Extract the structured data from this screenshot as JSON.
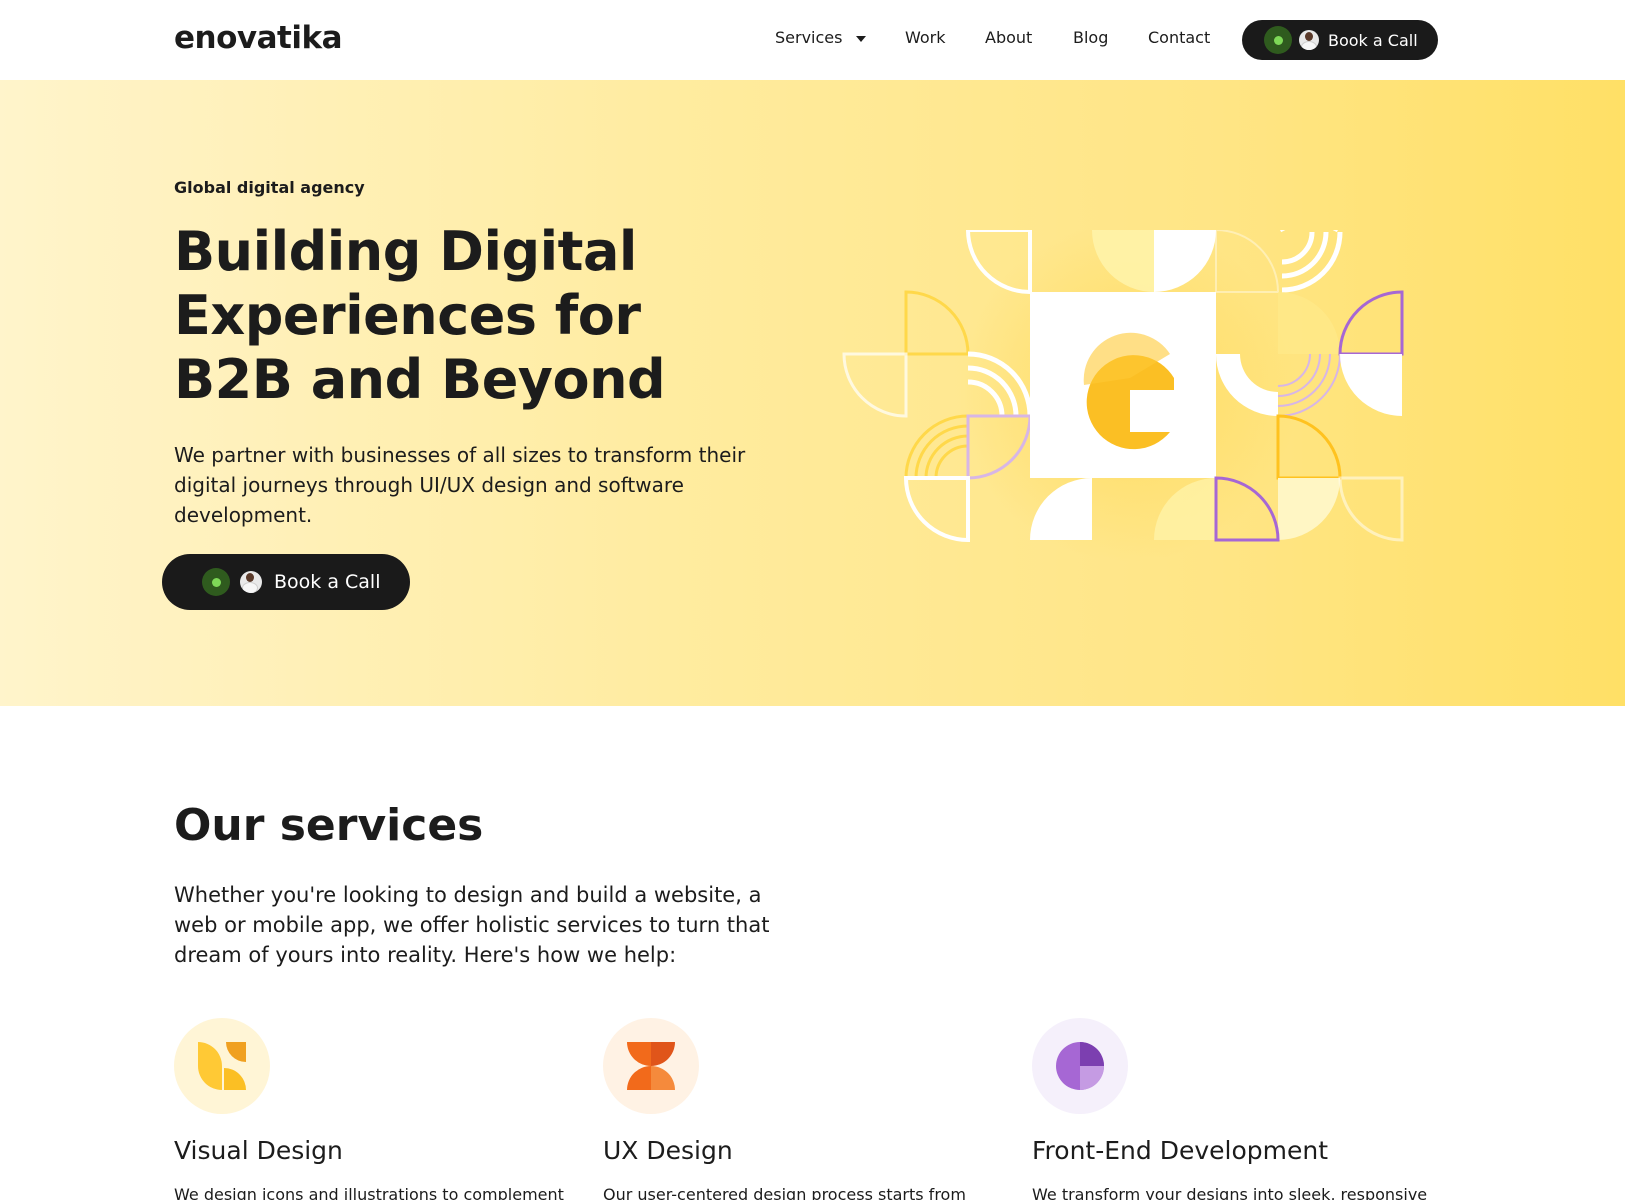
{
  "header": {
    "logo": "enovatika",
    "nav": {
      "services": "Services",
      "work": "Work",
      "about": "About",
      "blog": "Blog",
      "contact": "Contact"
    },
    "cta_label": "Book a Call"
  },
  "hero": {
    "eyebrow": "Global digital agency",
    "title": "Building Digital Experiences for B2B and Beyond",
    "description": "We partner with businesses of all sizes to transform their digital journeys through UI/UX design and software development.",
    "cta_label": "Book a Call"
  },
  "services": {
    "title": "Our services",
    "description": "Whether you're looking to design and build a website, a web or mobile app, we offer holistic services to turn that dream of yours into reality. Here's how we help:",
    "items": [
      {
        "icon": "leaf-shapes-icon",
        "title": "Visual Design",
        "text": "We design icons and illustrations to complement"
      },
      {
        "icon": "hourglass-shapes-icon",
        "title": "UX Design",
        "text": "Our user-centered design process starts from"
      },
      {
        "icon": "pie-shapes-icon",
        "title": "Front-End Development",
        "text": "We transform your designs into sleek, responsive"
      }
    ]
  },
  "colors": {
    "brand_dark": "#1a1a1a",
    "hero_yellow": "#ffe066",
    "accent_yellow": "#fbbf24",
    "accent_orange": "#f26a1b",
    "accent_purple": "#a667d4",
    "status_green": "#7ed957"
  }
}
